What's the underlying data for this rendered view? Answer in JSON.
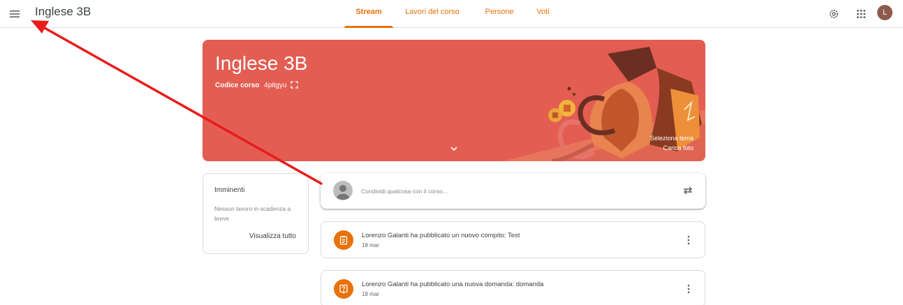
{
  "header": {
    "title": "Inglese 3B",
    "tabs": [
      {
        "label": "Stream",
        "active": true
      },
      {
        "label": "Lavori del corso",
        "active": false
      },
      {
        "label": "Persone",
        "active": false
      },
      {
        "label": "Voti",
        "active": false
      }
    ],
    "avatar_initial": "L",
    "icons": [
      "menu-icon",
      "gear-icon",
      "apps-grid-icon"
    ]
  },
  "banner": {
    "course_title": "Inglese 3B",
    "code_label": "Codice corso",
    "code_value": "4pitgyu",
    "select_theme": "Seleziona tema",
    "upload_photo": "Carica foto",
    "bg_color": "#e35d52"
  },
  "upcoming": {
    "title": "Imminenti",
    "empty_text": "Nessun lavoro in scadenza a breve",
    "view_all": "Visualizza tutto"
  },
  "share": {
    "placeholder": "Condividi qualcosa con il corso..."
  },
  "posts": [
    {
      "title": "Lorenzo Galanti ha pubblicato un nuovo compito: Test",
      "date": "18 mar",
      "icon": "assignment-icon"
    },
    {
      "title": "Lorenzo Galanti ha pubblicato una nuova domanda: domanda",
      "date": "18 mar",
      "icon": "question-icon"
    }
  ],
  "colors": {
    "accent": "#e8710a",
    "annotation_arrow": "#e81c1c"
  }
}
